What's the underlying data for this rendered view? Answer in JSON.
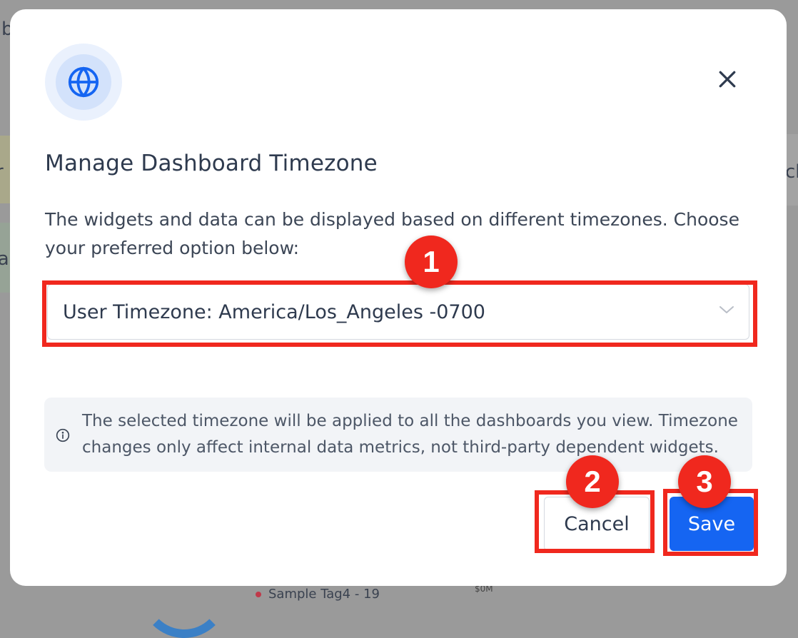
{
  "modal": {
    "title": "Manage Dashboard Timezone",
    "description": "The widgets and data can be displayed based on different timezones. Choose your preferred option below:",
    "icon": "globe-icon",
    "close_icon": "close-icon",
    "timezone_select": {
      "value": "User Timezone: America/Los_Angeles -0700",
      "chevron_icon": "chevron-down-icon"
    },
    "info": {
      "icon": "info-icon",
      "text": "The selected timezone will be applied to all the dashboards you view. Timezone changes only affect internal data metrics, not third-party dependent widgets."
    },
    "buttons": {
      "cancel": "Cancel",
      "save": "Save"
    }
  },
  "annotations": {
    "badge_1": "1",
    "badge_2": "2",
    "badge_3": "3"
  },
  "background": {
    "partial_text_1": "b",
    "partial_text_2": "r",
    "partial_text_3": "ra",
    "partial_text_4": "ch",
    "legend_item": "Sample Tag4 - 19",
    "axis_label": "$0M"
  },
  "colors": {
    "accent": "#1565f2",
    "annotation": "#f0281e",
    "overlay": "#9a9a9a",
    "icon_circle": "#d3e2fb"
  }
}
